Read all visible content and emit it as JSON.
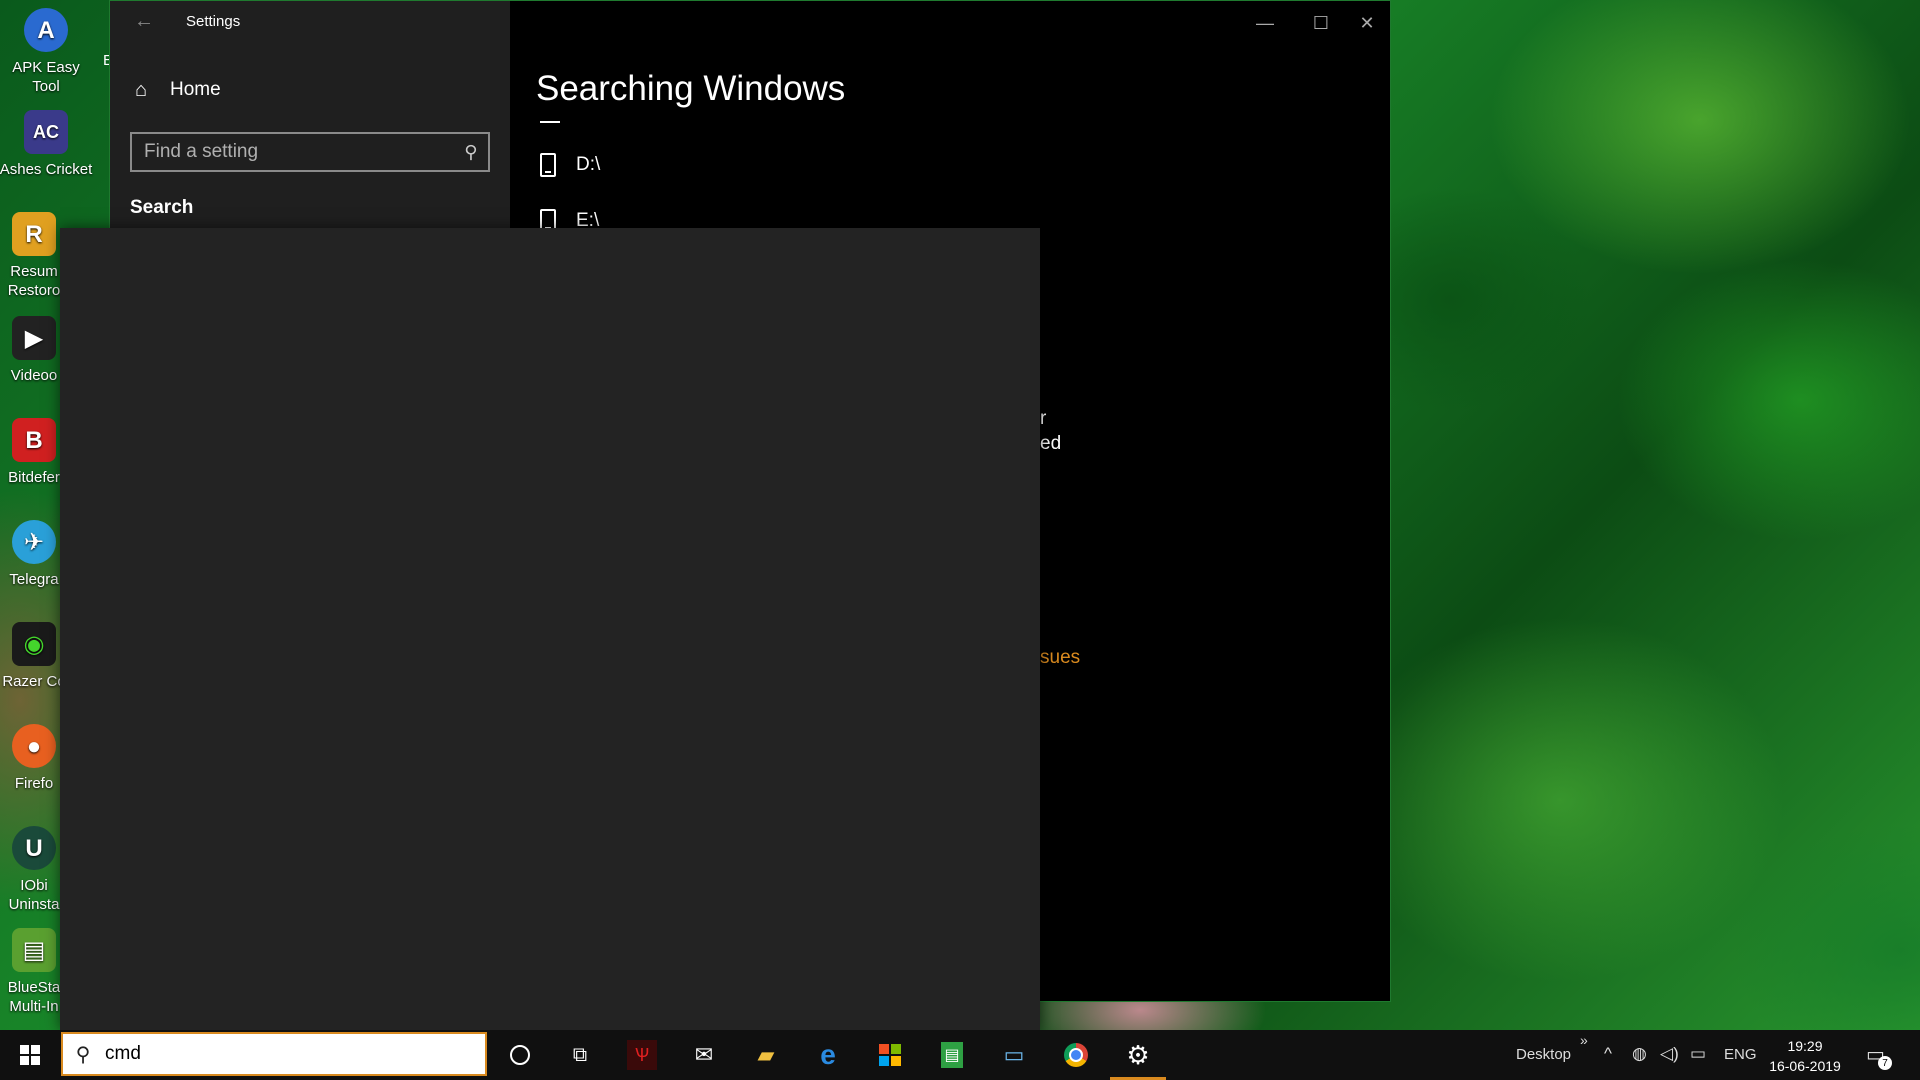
{
  "desktop": {
    "icons": [
      {
        "label": "APK Easy\nTool",
        "color": "#2a6ad0",
        "glyph": "A"
      },
      {
        "label": "Ashes Cricket",
        "color": "#3a3a8a",
        "glyph": "AC"
      },
      {
        "label": "Resum\nRestoro",
        "color": "#e0a020",
        "glyph": "R"
      },
      {
        "label": "Videoo",
        "color": "#222222",
        "glyph": "▶"
      },
      {
        "label": "Bitdefer",
        "color": "#d02020",
        "glyph": "B"
      },
      {
        "label": "Telegra",
        "color": "#2aa0d8",
        "glyph": "✈"
      },
      {
        "label": "Razer Co",
        "color": "#1a1a1a",
        "glyph": "◉"
      },
      {
        "label": "Firefo",
        "color": "#e86020",
        "glyph": "🦊"
      },
      {
        "label": "IObi\nUninsta",
        "color": "#1a4a3a",
        "glyph": "U"
      },
      {
        "label": "BlueSta\nMulti-In",
        "color": "#5aa030",
        "glyph": "▤"
      }
    ],
    "partial_label": "E"
  },
  "settings": {
    "window_title": "Settings",
    "back_icon": "back-arrow-icon",
    "home_label": "Home",
    "find_placeholder": "Find a setting",
    "section_heading": "Search",
    "page_title": "Searching Windows",
    "drives": [
      "D:\\",
      "E:\\"
    ],
    "partial_lines": [
      "r",
      "ed"
    ],
    "partial_link": "sues",
    "controls": {
      "minimize": "—",
      "maximize": "☐",
      "close": "✕"
    }
  },
  "taskbar": {
    "search_value": "cmd",
    "desktop_label": "Desktop",
    "chevron": "»",
    "language": "ENG",
    "time": "19:29",
    "date": "16-06-2019",
    "notification_count": "7",
    "apps": [
      "cortana-icon",
      "task-view-icon",
      "predator-icon",
      "mail-icon",
      "file-explorer-icon",
      "edge-icon",
      "store-icon",
      "notes-icon",
      "pc-icon",
      "chrome-icon",
      "settings-gear-icon"
    ]
  }
}
